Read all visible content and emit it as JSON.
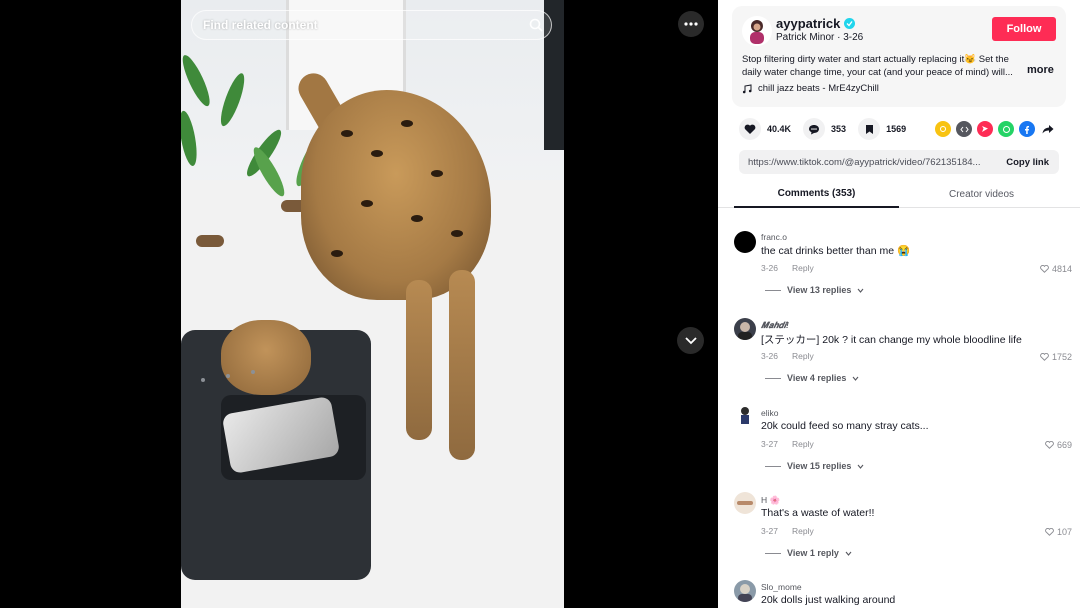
{
  "search": {
    "placeholder": "Find related content"
  },
  "author": {
    "username": "ayypatrick",
    "display_line": "Patrick Minor · 3-26",
    "follow_label": "Follow",
    "caption": "Stop filtering dirty water and start actually replacing it😼 Set the daily water change time, your cat (and your peace of mind) will...",
    "more_label": "more",
    "music": "chill jazz beats - MrE4zyChill"
  },
  "actions": {
    "likes": "40.4K",
    "comments": "353",
    "saves": "1569"
  },
  "share_icons": [
    "embed-coin-icon",
    "embed-code-icon",
    "send-icon",
    "whatsapp-icon",
    "facebook-icon",
    "share-arrow-icon"
  ],
  "link": {
    "url": "https://www.tiktok.com/@ayypatrick/video/762135184...",
    "copy_label": "Copy link"
  },
  "tabs": {
    "comments": "Comments (353)",
    "creator": "Creator videos"
  },
  "comments": [
    {
      "user": "franc.o",
      "text": "the cat drinks better than me 😭",
      "date": "3-26",
      "reply": "Reply",
      "likes": "4814",
      "replies": "View 13 replies"
    },
    {
      "user": "𝑴𝒂𝒉𝒅𝒊!",
      "text": "[ステッカー] 20k ? it can change my whole bloodline life",
      "date": "3-26",
      "reply": "Reply",
      "likes": "1752",
      "replies": "View 4 replies"
    },
    {
      "user": "eliko",
      "text": "20k could feed so many stray cats...",
      "date": "3-27",
      "reply": "Reply",
      "likes": "669",
      "replies": "View 15 replies"
    },
    {
      "user": "H 🌸",
      "text": "That's a waste of water!!",
      "date": "3-27",
      "reply": "Reply",
      "likes": "107",
      "replies": "View 1 reply"
    },
    {
      "user": "Slo_mome",
      "text": "20k dolls just walking around",
      "date": "",
      "reply": "",
      "likes": "",
      "replies": ""
    }
  ],
  "colors": {
    "follow": "#fe2c55",
    "verified": "#20d5ec"
  }
}
